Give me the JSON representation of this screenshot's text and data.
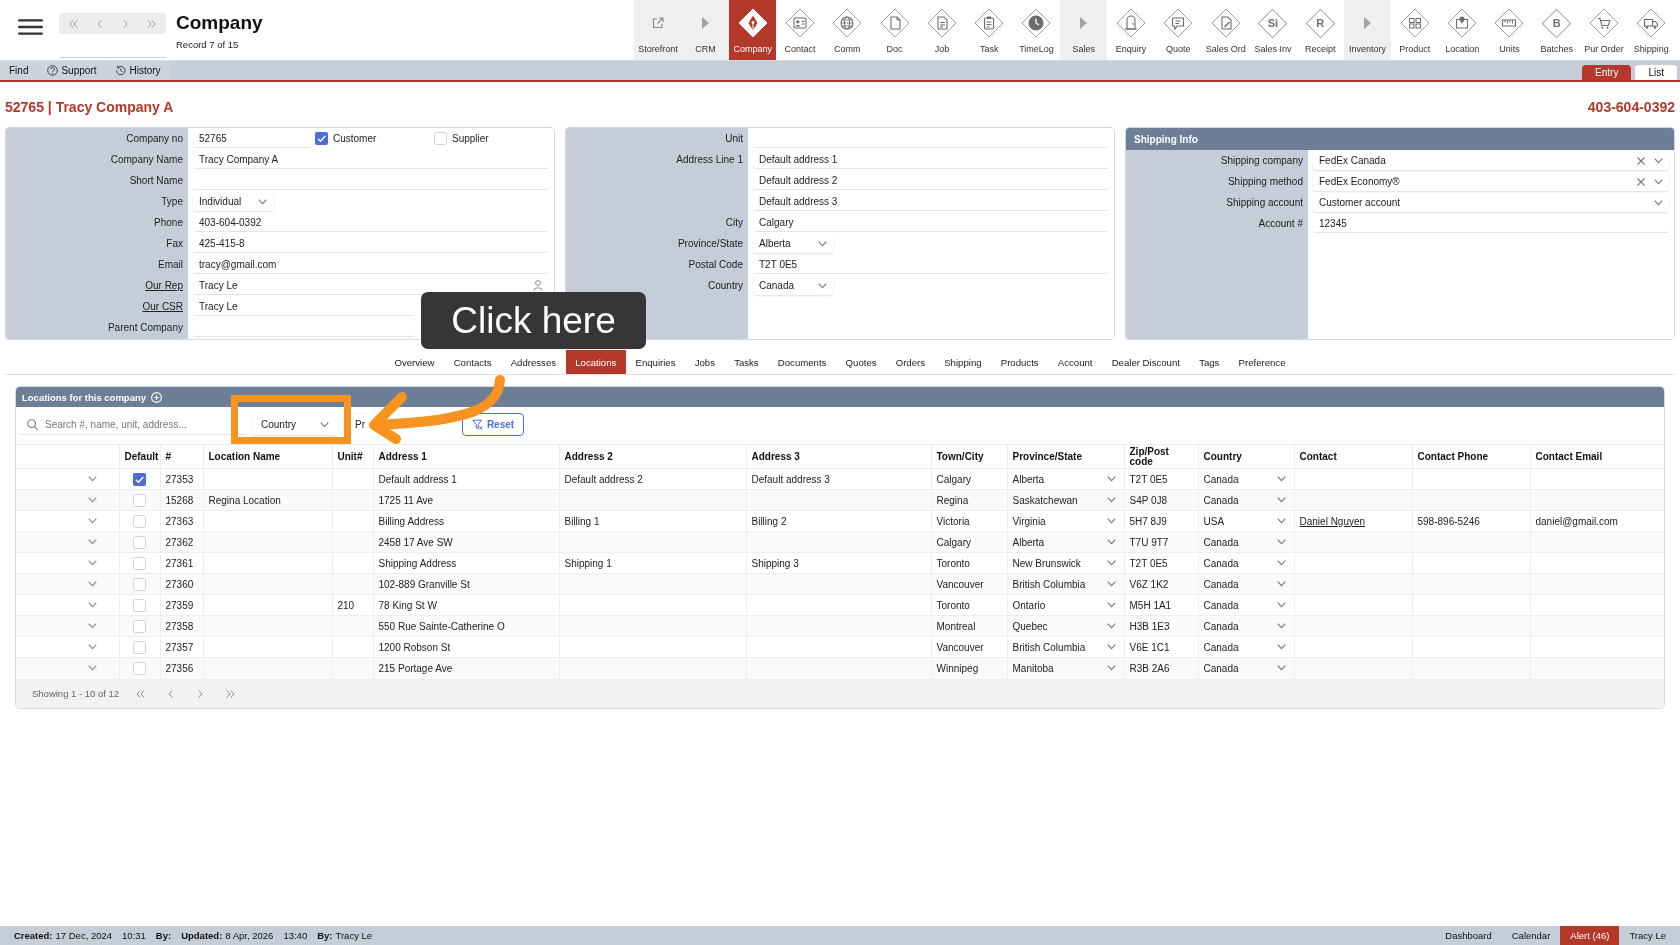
{
  "topbar": {
    "title": "Company",
    "subtitle": "Record 7 of 15",
    "modules": [
      {
        "label": "Storefront",
        "kind": "link",
        "selected": false
      },
      {
        "label": "CRM",
        "kind": "section",
        "selected": false
      },
      {
        "label": "Company",
        "kind": "module",
        "selected": true
      },
      {
        "label": "Contact",
        "kind": "module",
        "selected": false
      },
      {
        "label": "Comm",
        "kind": "module",
        "selected": false
      },
      {
        "label": "Doc",
        "kind": "module",
        "selected": false
      },
      {
        "label": "Job",
        "kind": "module",
        "selected": false
      },
      {
        "label": "Task",
        "kind": "module",
        "selected": false
      },
      {
        "label": "TimeLog",
        "kind": "module",
        "selected": false
      },
      {
        "label": "Sales",
        "kind": "section",
        "selected": false
      },
      {
        "label": "Enquiry",
        "kind": "module",
        "selected": false
      },
      {
        "label": "Quote",
        "kind": "module",
        "selected": false
      },
      {
        "label": "Sales Ord",
        "kind": "module",
        "selected": false
      },
      {
        "label": "Sales Inv",
        "kind": "module",
        "glyph": "Si",
        "selected": false
      },
      {
        "label": "Receipt",
        "kind": "module",
        "glyph": "R",
        "selected": false
      },
      {
        "label": "Inventory",
        "kind": "section",
        "selected": false
      },
      {
        "label": "Product",
        "kind": "module",
        "selected": false
      },
      {
        "label": "Location",
        "kind": "module",
        "selected": false
      },
      {
        "label": "Units",
        "kind": "module",
        "selected": false
      },
      {
        "label": "Batches",
        "kind": "module",
        "glyph": "B",
        "selected": false
      },
      {
        "label": "Pur Order",
        "kind": "module",
        "selected": false
      },
      {
        "label": "Shipping",
        "kind": "module",
        "selected": false
      }
    ]
  },
  "subbar": {
    "tools": [
      {
        "label": "Find"
      },
      {
        "label": "Support"
      },
      {
        "label": "History"
      }
    ],
    "views": [
      {
        "label": "Entry",
        "selected": true
      },
      {
        "label": "List",
        "selected": false
      }
    ]
  },
  "record": {
    "title": "52765 | Tracy Company A",
    "phone": "403-604-0392"
  },
  "company_panel": {
    "fields": [
      {
        "label": "Company no",
        "kind": "text",
        "link": false,
        "value": "52765",
        "checks": [
          {
            "label": "Customer",
            "checked": true
          },
          {
            "label": "Supplier",
            "checked": false
          }
        ]
      },
      {
        "label": "Company Name",
        "kind": "text",
        "link": false,
        "value": "Tracy Company A"
      },
      {
        "label": "Short Name",
        "kind": "text",
        "link": false
      },
      {
        "label": "Type",
        "kind": "select",
        "link": false,
        "value": "Individual"
      },
      {
        "label": "Phone",
        "kind": "text",
        "link": false,
        "value": "403-604-0392"
      },
      {
        "label": "Fax",
        "kind": "text",
        "link": false,
        "value": "425-415-8"
      },
      {
        "label": "Email",
        "kind": "text",
        "link": false,
        "value": "tracy@gmail.com"
      },
      {
        "label": "Our Rep",
        "kind": "lookup",
        "link": true,
        "value": "Tracy Le"
      },
      {
        "label": "Our CSR",
        "kind": "text",
        "link": true,
        "value": "Tracy Le"
      },
      {
        "label": "Parent Company",
        "kind": "text",
        "link": false
      }
    ]
  },
  "address_panel": {
    "fields": [
      {
        "label": "Unit",
        "kind": "text"
      },
      {
        "label": "Address Line 1",
        "kind": "text",
        "value": "Default address 1"
      },
      {
        "kind": "text",
        "value": "Default address 2"
      },
      {
        "kind": "text",
        "value": "Default address 3"
      },
      {
        "label": "City",
        "kind": "text",
        "value": "Calgary"
      },
      {
        "label": "Province/State",
        "kind": "select",
        "value": "Alberta"
      },
      {
        "label": "Postal Code",
        "kind": "text",
        "value": "T2T 0E5"
      },
      {
        "label": "Country",
        "kind": "select",
        "value": "Canada"
      }
    ]
  },
  "shipping_panel": {
    "title": "Shipping Info",
    "fields": [
      {
        "label": "Shipping company",
        "kind": "select",
        "clearable": true,
        "value": "FedEx Canada"
      },
      {
        "label": "Shipping method",
        "kind": "select",
        "clearable": true,
        "value": "FedEx Economy®"
      },
      {
        "label": "Shipping account",
        "kind": "select",
        "clearable": false,
        "value": "Customer account"
      },
      {
        "label": "Account #",
        "kind": "text",
        "clearable": false,
        "value": "12345"
      }
    ]
  },
  "tabs": [
    {
      "label": "Overview",
      "selected": false
    },
    {
      "label": "Contacts",
      "selected": false
    },
    {
      "label": "Addresses",
      "selected": false
    },
    {
      "label": "Locations",
      "selected": true
    },
    {
      "label": "Enquiries",
      "selected": false
    },
    {
      "label": "Jobs",
      "selected": false
    },
    {
      "label": "Tasks",
      "selected": false
    },
    {
      "label": "Documents",
      "selected": false
    },
    {
      "label": "Quotes",
      "selected": false
    },
    {
      "label": "Orders",
      "selected": false
    },
    {
      "label": "Shipping",
      "selected": false
    },
    {
      "label": "Products",
      "selected": false
    },
    {
      "label": "Account",
      "selected": false
    },
    {
      "label": "Dealer Discount",
      "selected": false
    },
    {
      "label": "Tags",
      "selected": false
    },
    {
      "label": "Preference",
      "selected": false
    }
  ],
  "locations": {
    "title": "Locations for this company",
    "filters": [
      {
        "kind": "search",
        "placeholder": "Search #, name, unit, address..."
      },
      {
        "kind": "select",
        "value": "Country"
      },
      {
        "kind": "field",
        "value": "Pr"
      }
    ],
    "reset_label": "Reset",
    "columns": [
      "Default",
      "#",
      "Location Name",
      "Unit#",
      "Address 1",
      "Address 2",
      "Address 3",
      "Town/City",
      "Province/State",
      "Zip/Post code",
      "Country",
      "Contact",
      "Contact Phone",
      "Contact Email"
    ],
    "rows": [
      {
        "default": true,
        "number": "27353",
        "address_1": "Default address 1",
        "address_2": "Default address 2",
        "address_3": "Default address 3",
        "town_city": "Calgary",
        "province_state": "Alberta",
        "zip_post_code": "T2T 0E5",
        "country": "Canada"
      },
      {
        "default": false,
        "number": "15268",
        "location_name": "Regina Location",
        "address_1": "1725 11 Ave",
        "town_city": "Regina",
        "province_state": "Saskatchewan",
        "zip_post_code": "S4P 0J8",
        "country": "Canada"
      },
      {
        "default": false,
        "number": "27363",
        "address_1": "Billing Address",
        "address_2": "Billing 1",
        "address_3": "Billing 2",
        "town_city": "Victoria",
        "province_state": "Virginia",
        "zip_post_code": "5H7 8J9",
        "country": "USA",
        "contact": "Daniel Nguyen",
        "contact_phone": "598-896-5246",
        "contact_email": "daniel@gmail.com"
      },
      {
        "default": false,
        "number": "27362",
        "address_1": "2458 17 Ave SW",
        "town_city": "Calgary",
        "province_state": "Alberta",
        "zip_post_code": "T7U 9T7",
        "country": "Canada"
      },
      {
        "default": false,
        "number": "27361",
        "address_1": "Shipping Address",
        "address_2": "Shipping 1",
        "address_3": "Shipping 3",
        "town_city": "Toronto",
        "province_state": "New Brunswick",
        "zip_post_code": "T2T 0E5",
        "country": "Canada"
      },
      {
        "default": false,
        "number": "27360",
        "address_1": "102-889 Granville St",
        "town_city": "Vancouver",
        "province_state": "British Columbia",
        "zip_post_code": "V6Z 1K2",
        "country": "Canada"
      },
      {
        "default": false,
        "number": "27359",
        "unit": "210",
        "address_1": "78 King St W",
        "town_city": "Toronto",
        "province_state": "Ontario",
        "zip_post_code": "M5H 1A1",
        "country": "Canada"
      },
      {
        "default": false,
        "number": "27358",
        "address_1": "550 Rue Sainte-Catherine O",
        "town_city": "Montreal",
        "province_state": "Quebec",
        "zip_post_code": "H3B 1E3",
        "country": "Canada"
      },
      {
        "default": false,
        "number": "27357",
        "address_1": "1200 Robson St",
        "town_city": "Vancouver",
        "province_state": "British Columbia",
        "zip_post_code": "V6E 1C1",
        "country": "Canada"
      },
      {
        "default": false,
        "number": "27356",
        "address_1": "215 Portage Ave",
        "town_city": "Winnipeg",
        "province_state": "Manitoba",
        "zip_post_code": "R3B 2A6",
        "country": "Canada"
      }
    ],
    "footer": "Showing 1 - 10 of 12"
  },
  "status_bar": {
    "details": [
      {
        "label": "Created:",
        "value": "17 Dec, 2024"
      },
      {
        "value": "10:31"
      },
      {
        "label": "By:"
      },
      {
        "label": "Updated:",
        "value": "8 Apr, 2026"
      },
      {
        "value": "13:40"
      },
      {
        "label": "By:",
        "value": "Tracy Le"
      }
    ],
    "links": [
      {
        "label": "Dashboard",
        "kind": "link"
      },
      {
        "label": "Calendar",
        "kind": "link"
      },
      {
        "label": "Alert (46)",
        "kind": "alert"
      },
      {
        "label": "Tracy Le",
        "kind": "user"
      }
    ]
  },
  "overlay": {
    "callout": "Click here"
  }
}
